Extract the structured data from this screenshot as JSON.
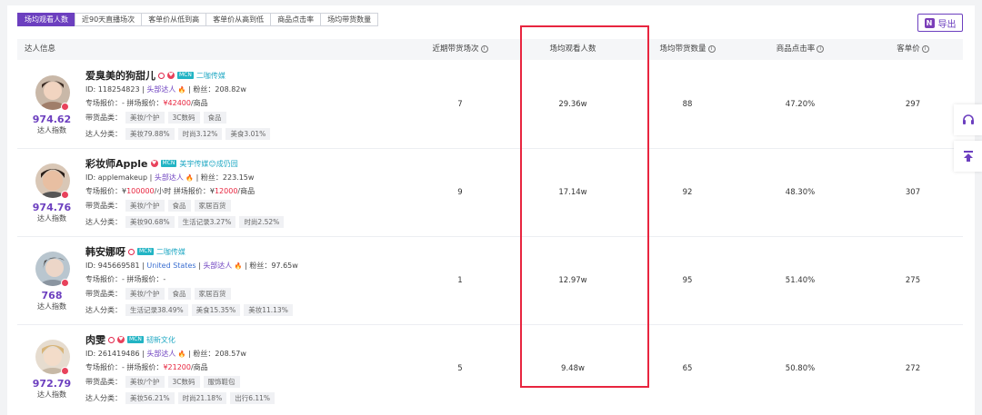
{
  "tabs": [
    {
      "label": "场均观看人数",
      "active": true
    },
    {
      "label": "近90天直播场次",
      "active": false
    },
    {
      "label": "客单价从低到高",
      "active": false
    },
    {
      "label": "客单价从高到低",
      "active": false
    },
    {
      "label": "商品点击率",
      "active": false
    },
    {
      "label": "场均带货数量",
      "active": false
    }
  ],
  "export_label": "导出",
  "headers": {
    "info": "达人信息",
    "recent_sessions": "近期带货场次",
    "avg_viewers": "场均观看人数",
    "avg_goods": "场均带货数量",
    "click_rate": "商品点击率",
    "unit_price": "客单价"
  },
  "rows": [
    {
      "name": "爱臭美的狗甜儿",
      "mcn": "二咖传媒",
      "id_text": "ID: 118254823",
      "level": "头部达人",
      "fans": "粉丝：208.82w",
      "price_text_1": "专场报价：-   拼场报价：",
      "price_value": "¥42400",
      "price_unit": "/商品",
      "goods_label": "带货品类：",
      "goods": [
        "美妆/个护",
        "3C数码",
        "食品"
      ],
      "cat_label": "达人分类：",
      "cats": [
        "美妆79.88%",
        "时尚3.12%",
        "美食3.01%"
      ],
      "index": "974.62",
      "index_label": "达人指数",
      "sessions": "7",
      "viewers": "29.36w",
      "goods_count": "88",
      "click": "47.20%",
      "unit": "297"
    },
    {
      "name": "彩妆师Apple",
      "mcn": "美宇传媒😊成仍园",
      "id_text": "ID: applemakeup",
      "level": "头部达人",
      "fans": "粉丝：223.15w",
      "price_text_1": "专场报价：¥",
      "price_value_1": "100000",
      "price_mid": "/小时  拼场报价：¥",
      "price_value": "12000",
      "price_unit": "/商品",
      "goods_label": "带货品类：",
      "goods": [
        "美妆/个护",
        "食品",
        "家居百货"
      ],
      "cat_label": "达人分类：",
      "cats": [
        "美妆90.68%",
        "生活记录3.27%",
        "时尚2.52%"
      ],
      "index": "974.76",
      "index_label": "达人指数",
      "sessions": "9",
      "viewers": "17.14w",
      "goods_count": "92",
      "click": "48.30%",
      "unit": "307"
    },
    {
      "name": "韩安娜呀",
      "mcn": "二咖传媒",
      "id_text": "ID: 945669581",
      "region": "United States",
      "level": "头部达人",
      "fans": "粉丝：97.65w",
      "price_text_1": "专场报价：-   拼场报价：-",
      "goods_label": "带货品类：",
      "goods": [
        "美妆/个护",
        "食品",
        "家居百货"
      ],
      "cat_label": "达人分类：",
      "cats": [
        "生活记录38.49%",
        "美食15.35%",
        "美妆11.13%"
      ],
      "index": "768",
      "index_label": "达人指数",
      "sessions": "1",
      "viewers": "12.97w",
      "goods_count": "95",
      "click": "51.40%",
      "unit": "275"
    },
    {
      "name": "肉雯",
      "mcn": "韧新文化",
      "id_text": "ID: 261419486",
      "level": "头部达人",
      "fans": "粉丝：208.57w",
      "price_text_1": "专场报价：-   拼场报价：",
      "price_value": "¥21200",
      "price_unit": "/商品",
      "goods_label": "带货品类：",
      "goods": [
        "美妆/个护",
        "3C数码",
        "服饰鞋包"
      ],
      "cat_label": "达人分类：",
      "cats": [
        "美妆56.21%",
        "时尚21.18%",
        "出行6.11%"
      ],
      "index": "972.79",
      "index_label": "达人指数",
      "sessions": "5",
      "viewers": "9.48w",
      "goods_count": "65",
      "click": "50.80%",
      "unit": "272"
    }
  ],
  "mcn_badge": "MCN",
  "colors": {
    "accent": "#6c3fbf",
    "highlight_box": "#e8253f"
  }
}
